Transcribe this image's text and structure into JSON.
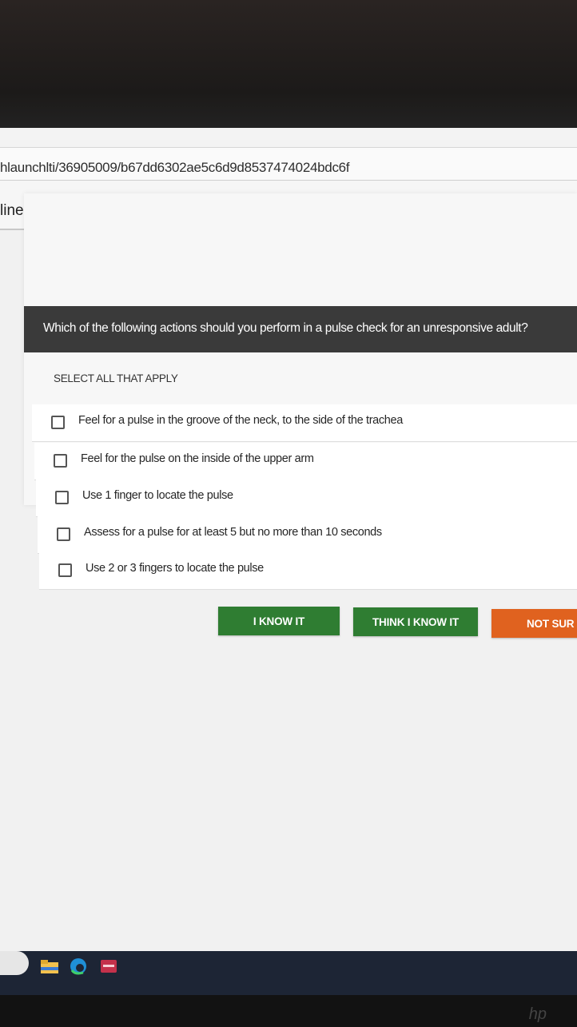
{
  "browser": {
    "url": "hlaunchlti/36905009/b67dd6302ae5c6d9d8537474024bdc6f",
    "tab_label": "line"
  },
  "question": {
    "text": "Which of the following actions should you perform in a pulse check for an unresponsive adult?",
    "instruction": "SELECT ALL THAT APPLY",
    "options": [
      {
        "label": "Feel for a pulse in the groove of the neck, to the side of the trachea",
        "checked": false
      },
      {
        "label": "Feel for the pulse on the inside of the upper arm",
        "checked": false
      },
      {
        "label": "Use 1 finger to locate the pulse",
        "checked": false
      },
      {
        "label": "Assess for a pulse for at least 5 but no more than 10 seconds",
        "checked": false
      },
      {
        "label": "Use 2 or 3 fingers to locate the pulse",
        "checked": false
      }
    ]
  },
  "buttons": {
    "know_it": "I KNOW IT",
    "think_know_it": "THINK I KNOW IT",
    "not_sure": "NOT SUR"
  },
  "colors": {
    "question_bar": "#3a3a3a",
    "green_button": "#2f7d32",
    "orange_button": "#e0621f"
  },
  "taskbar": {
    "icons": [
      "search-pill",
      "file-explorer-icon",
      "edge-icon",
      "app-icon"
    ]
  }
}
